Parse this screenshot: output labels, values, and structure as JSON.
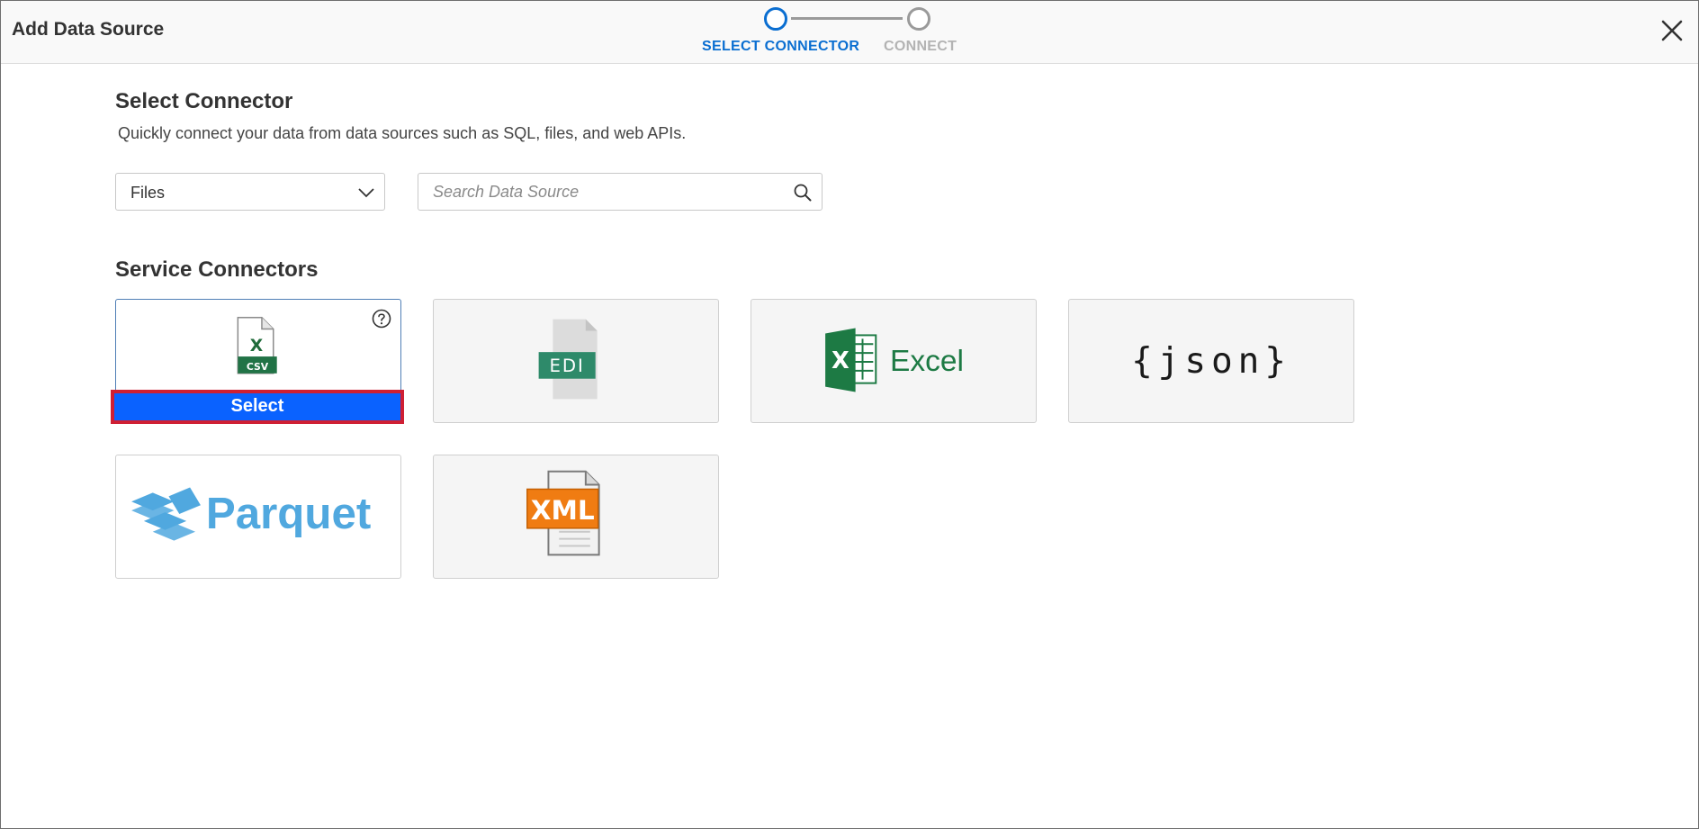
{
  "header": {
    "title": "Add Data Source",
    "close_icon": "close-icon"
  },
  "stepper": {
    "steps": [
      {
        "label": "SELECT CONNECTOR",
        "state": "active"
      },
      {
        "label": "CONNECT",
        "state": "inactive"
      }
    ]
  },
  "main": {
    "title": "Select Connector",
    "subtitle": "Quickly connect your data from data sources such as SQL, files, and web APIs.",
    "category_select": {
      "value": "Files",
      "icon": "chevron-down-icon"
    },
    "search": {
      "value": "",
      "placeholder": "Search Data Source",
      "icon": "search-icon"
    },
    "services_title": "Service Connectors"
  },
  "connectors": [
    {
      "id": "csv",
      "logo_text": "X",
      "badge": "CSV",
      "selected": true,
      "help_icon": "help-icon",
      "button_label": "Select"
    },
    {
      "id": "edi",
      "badge": "EDI"
    },
    {
      "id": "excel",
      "logo_mark": "X",
      "logo_text": "Excel"
    },
    {
      "id": "json",
      "logo_text": "{json}"
    },
    {
      "id": "parquet",
      "logo_text": "Parquet"
    },
    {
      "id": "xml",
      "badge": "XML"
    }
  ],
  "colors": {
    "accent": "#0a6ed1",
    "select_button": "#0a62ff",
    "highlight_border": "#cf1f34",
    "excel_green": "#1d7a44",
    "parquet_blue": "#50a8df",
    "xml_orange": "#f07c12"
  }
}
